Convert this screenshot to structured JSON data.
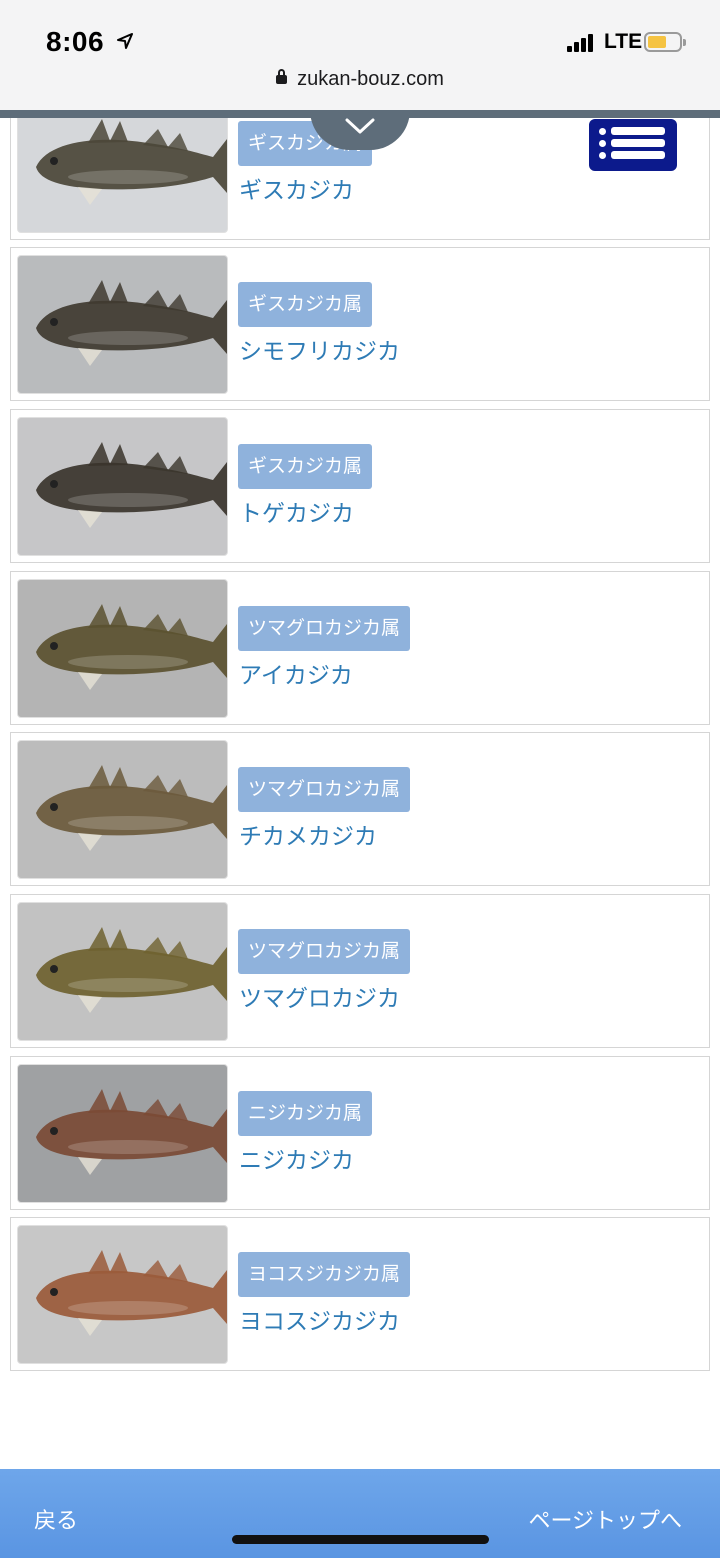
{
  "status_bar": {
    "time": "8:06",
    "network": "LTE",
    "battery_color": "#f5c342"
  },
  "browser": {
    "url": "zukan-bouz.com"
  },
  "menu": {
    "icon": "list-menu-icon",
    "color": "#0c1a8c"
  },
  "items": [
    {
      "genus": "ギスカジカ属",
      "name": "ギスカジカ",
      "photo_bg": "#d5d7da",
      "fish_color": "#4b4738"
    },
    {
      "genus": "ギスカジカ属",
      "name": "シモフリカジカ",
      "photo_bg": "#b9bbbd",
      "fish_color": "#3f3a30"
    },
    {
      "genus": "ギスカジカ属",
      "name": "トゲカジカ",
      "photo_bg": "#c6c6c8",
      "fish_color": "#3a342c"
    },
    {
      "genus": "ツマグロカジカ属",
      "name": "アイカジカ",
      "photo_bg": "#b4b4b4",
      "fish_color": "#5b5130"
    },
    {
      "genus": "ツマグロカジカ属",
      "name": "チカメカジカ",
      "photo_bg": "#bcbcbc",
      "fish_color": "#6b5a3c"
    },
    {
      "genus": "ツマグロカジカ属",
      "name": "ツマグロカジカ",
      "photo_bg": "#c2c2c2",
      "fish_color": "#6f6230"
    },
    {
      "genus": "ニジカジカ属",
      "name": "ニジカジカ",
      "photo_bg": "#9fa1a3",
      "fish_color": "#7a4a35"
    },
    {
      "genus": "ヨコスジカジカ属",
      "name": "ヨコスジカジカ",
      "photo_bg": "#c7c7c7",
      "fish_color": "#9a5a3a"
    }
  ],
  "footer": {
    "back_label": "戻る",
    "top_label": "ページトップへ"
  }
}
